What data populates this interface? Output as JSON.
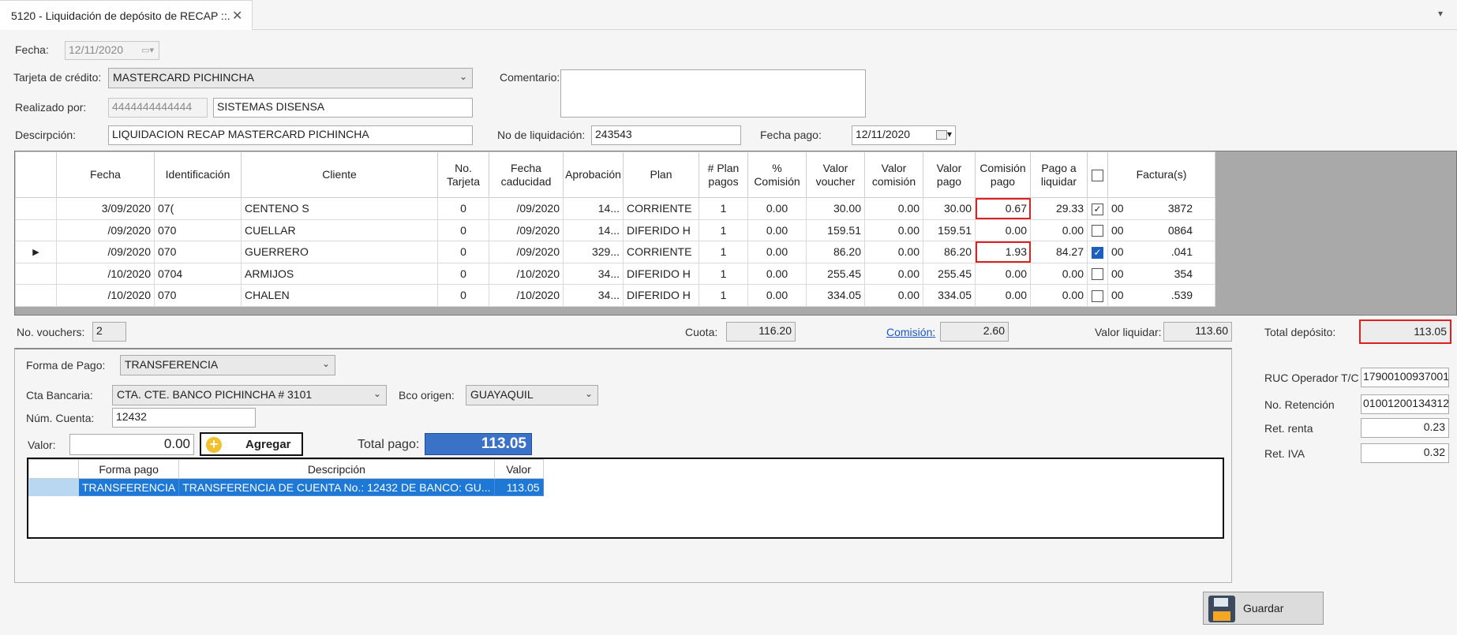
{
  "tab": {
    "title": "5120 - Liquidación de depósito de RECAP ::.",
    "close": "✕"
  },
  "form": {
    "fecha_label": "Fecha:",
    "fecha_value": "12/11/2020",
    "tarjeta_label": "Tarjeta de crédito:",
    "tarjeta_value": "MASTERCARD PICHINCHA",
    "comentario_label": "Comentario:",
    "comentario_value": "",
    "realizado_label": "Realizado por:",
    "realizado_id": "4444444444444",
    "realizado_name": "SISTEMAS DISENSA",
    "descripcion_label": "Descirpción:",
    "descripcion_value": "LIQUIDACION RECAP MASTERCARD PICHINCHA",
    "no_liquidacion_label": "No de liquidación:",
    "no_liquidacion_value": "243543",
    "fecha_pago_label": "Fecha pago:",
    "fecha_pago_value": "12/11/2020"
  },
  "grid": {
    "headers": [
      "Fecha",
      "Identificación",
      "Cliente",
      "No.\nTarjeta",
      "Fecha\ncaducidad",
      "Aprobación",
      "Plan",
      "# Plan\npagos",
      "%\nComisión",
      "Valor\nvoucher",
      "Valor\ncomisión",
      "Valor\npago",
      "Comisión\npago",
      "Pago a\nliquidar",
      "",
      "Factura(s)"
    ],
    "rows": [
      {
        "fecha": "3/09/2020",
        "ident": "07(",
        "cliente": "CENTENO S",
        "tarjeta": "0",
        "caducidad": "/09/2020",
        "aprob": "14...",
        "plan": "CORRIENTE",
        "plan_pagos": "1",
        "pct": "0.00",
        "voucher": "30.00",
        "val_com": "0.00",
        "val_pago": "30.00",
        "com_pago": "0.67",
        "liquidar": "29.33",
        "checked": true,
        "chk_style": "normal",
        "f1": "00",
        "f2": "3872",
        "com_red": true,
        "current": false
      },
      {
        "fecha": "/09/2020",
        "ident": "070",
        "cliente": "CUELLAR",
        "tarjeta": "0",
        "caducidad": "/09/2020",
        "aprob": "14...",
        "plan": "DIFERIDO H",
        "plan_pagos": "1",
        "pct": "0.00",
        "voucher": "159.51",
        "val_com": "0.00",
        "val_pago": "159.51",
        "com_pago": "0.00",
        "liquidar": "0.00",
        "checked": false,
        "chk_style": "normal",
        "f1": "00",
        "f2": "0864",
        "com_red": false,
        "current": false
      },
      {
        "fecha": "/09/2020",
        "ident": "070",
        "cliente": "GUERRERO",
        "tarjeta": "0",
        "caducidad": "/09/2020",
        "aprob": "329...",
        "plan": "CORRIENTE",
        "plan_pagos": "1",
        "pct": "0.00",
        "voucher": "86.20",
        "val_com": "0.00",
        "val_pago": "86.20",
        "com_pago": "1.93",
        "liquidar": "84.27",
        "checked": true,
        "chk_style": "blue",
        "f1": "00",
        "f2": ".041",
        "com_red": true,
        "current": true
      },
      {
        "fecha": "/10/2020",
        "ident": "0704",
        "cliente": "ARMIJOS",
        "tarjeta": "0",
        "caducidad": "/10/2020",
        "aprob": "34...",
        "plan": "DIFERIDO H",
        "plan_pagos": "1",
        "pct": "0.00",
        "voucher": "255.45",
        "val_com": "0.00",
        "val_pago": "255.45",
        "com_pago": "0.00",
        "liquidar": "0.00",
        "checked": false,
        "chk_style": "normal",
        "f1": "00",
        "f2": "354",
        "com_red": false,
        "current": false
      },
      {
        "fecha": "/10/2020",
        "ident": "070",
        "cliente": "CHALEN",
        "tarjeta": "0",
        "caducidad": "/10/2020",
        "aprob": "34...",
        "plan": "DIFERIDO H",
        "plan_pagos": "1",
        "pct": "0.00",
        "voucher": "334.05",
        "val_com": "0.00",
        "val_pago": "334.05",
        "com_pago": "0.00",
        "liquidar": "0.00",
        "checked": false,
        "chk_style": "normal",
        "f1": "00",
        "f2": ".539",
        "com_red": false,
        "current": false
      }
    ]
  },
  "summary": {
    "vouchers_label": "No. vouchers:",
    "vouchers_value": "2",
    "cuota_label": "Cuota:",
    "cuota_value": "116.20",
    "comision_label": "Comisión:",
    "comision_value": "2.60",
    "valor_liquidar_label": "Valor liquidar:",
    "valor_liquidar_value": "113.60",
    "total_deposito_label": "Total depósito:",
    "total_deposito_value": "113.05"
  },
  "payment": {
    "forma_label": "Forma de Pago:",
    "forma_value": "TRANSFERENCIA",
    "cta_label": "Cta Bancaria:",
    "cta_value": "CTA. CTE. BANCO PICHINCHA # 3101",
    "bco_label": "Bco origen:",
    "bco_value": "GUAYAQUIL",
    "num_cuenta_label": "Núm. Cuenta:",
    "num_cuenta_value": "12432",
    "valor_label": "Valor:",
    "valor_value": "0.00",
    "agregar_label": "Agregar",
    "total_pago_label": "Total pago:",
    "total_pago_value": "113.05",
    "table_headers": [
      "Forma pago",
      "Descripción",
      "Valor"
    ],
    "table_rows": [
      {
        "forma": "TRANSFERENCIA",
        "desc": "TRANSFERENCIA DE CUENTA No.: 12432 DE BANCO: GU...",
        "valor": "113.05"
      }
    ]
  },
  "right_panel": {
    "ruc_label": "RUC Operador T/C",
    "ruc_value": "17900100937001",
    "retencion_label": "No. Retención",
    "retencion_value": "01001200134312",
    "renta_label": "Ret. renta",
    "renta_value": "0.23",
    "iva_label": "Ret. IVA",
    "iva_value": "0.32"
  },
  "actions": {
    "guardar_label": "Guardar"
  },
  "colors": {
    "accent_blue": "#1d78d6",
    "highlight_red": "#e02020",
    "total_pago_bg": "#3a72c8"
  }
}
